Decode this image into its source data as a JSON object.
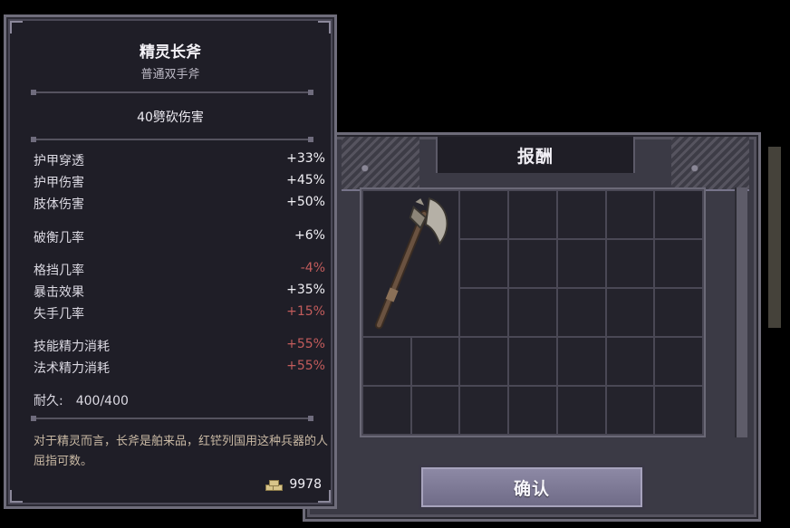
{
  "reward": {
    "title": "报酬",
    "confirm_label": "确认"
  },
  "item": {
    "name": "精灵长斧",
    "type": "普通双手斧",
    "damage": "40劈砍伤害",
    "stats": [
      {
        "label": "护甲穿透",
        "value": "+33%",
        "kind": "pos"
      },
      {
        "label": "护甲伤害",
        "value": "+45%",
        "kind": "pos"
      },
      {
        "label": "肢体伤害",
        "value": "+50%",
        "kind": "pos"
      },
      {
        "label": "破衡几率",
        "value": "+6%",
        "kind": "pos"
      },
      {
        "label": "格挡几率",
        "value": "-4%",
        "kind": "neg"
      },
      {
        "label": "暴击效果",
        "value": "+35%",
        "kind": "pos"
      },
      {
        "label": "失手几率",
        "value": "+15%",
        "kind": "neg"
      },
      {
        "label": "技能精力消耗",
        "value": "+55%",
        "kind": "neg"
      },
      {
        "label": "法术精力消耗",
        "value": "+55%",
        "kind": "neg"
      }
    ],
    "durability_label": "耐久:",
    "durability_value": "400/400",
    "description": "对于精灵而言，长斧是舶来品，红铓列国用这种兵器的人屈指可数。",
    "price": "9978",
    "price_icon": "coin-stack-icon"
  },
  "colors": {
    "positive": "#f2f1f6",
    "negative": "#c35c5c",
    "description": "#c9b9a4"
  }
}
